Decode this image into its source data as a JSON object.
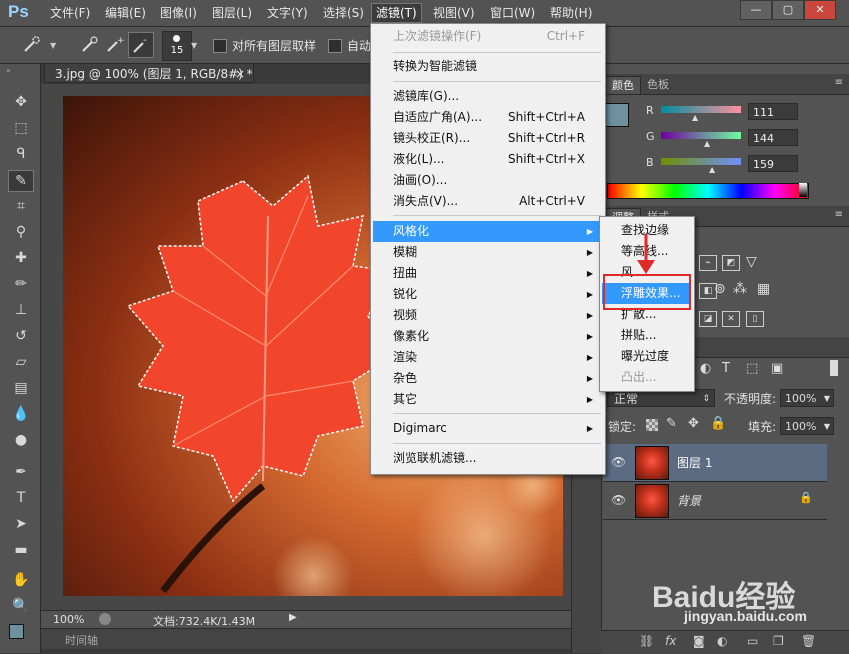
{
  "app": {
    "logo": "Ps"
  },
  "menubar": {
    "items": [
      "文件(F)",
      "编辑(E)",
      "图像(I)",
      "图层(L)",
      "文字(Y)",
      "选择(S)",
      "滤镜(T)",
      "视图(V)",
      "窗口(W)",
      "帮助(H)"
    ],
    "active": "滤镜(T)",
    "window_buttons": [
      "—",
      "▢",
      "✕"
    ]
  },
  "options": {
    "brush_size": "15",
    "sample_all_layers": "对所有图层取样",
    "auto_enhance": "自动"
  },
  "document": {
    "tab_title": "3.jpg @ 100% (图层 1, RGB/8#) *",
    "tab_close": "×"
  },
  "status": {
    "zoom": "100%",
    "doc_info": "文档:732.4K/1.43M"
  },
  "timeline": {
    "label": "时间轴"
  },
  "filter_menu": {
    "items": [
      {
        "label": "上次滤镜操作(F)",
        "shortcut": "Ctrl+F",
        "disabled": true
      },
      {
        "label": "转换为智能滤镜"
      },
      {
        "label": "滤镜库(G)..."
      },
      {
        "label": "自适应广角(A)...",
        "shortcut": "Shift+Ctrl+A"
      },
      {
        "label": "镜头校正(R)...",
        "shortcut": "Shift+Ctrl+R"
      },
      {
        "label": "液化(L)...",
        "shortcut": "Shift+Ctrl+X"
      },
      {
        "label": "油画(O)..."
      },
      {
        "label": "消失点(V)...",
        "shortcut": "Alt+Ctrl+V"
      },
      {
        "label": "风格化",
        "submenu": true,
        "highlighted": true
      },
      {
        "label": "模糊",
        "submenu": true
      },
      {
        "label": "扭曲",
        "submenu": true
      },
      {
        "label": "锐化",
        "submenu": true
      },
      {
        "label": "视频",
        "submenu": true
      },
      {
        "label": "像素化",
        "submenu": true
      },
      {
        "label": "渲染",
        "submenu": true
      },
      {
        "label": "杂色",
        "submenu": true
      },
      {
        "label": "其它",
        "submenu": true
      },
      {
        "label": "Digimarc",
        "submenu": true
      },
      {
        "label": "浏览联机滤镜..."
      }
    ]
  },
  "stylize_submenu": {
    "items": [
      {
        "label": "查找边缘"
      },
      {
        "label": "等高线..."
      },
      {
        "label": "风..."
      },
      {
        "label": "浮雕效果...",
        "highlighted": true
      },
      {
        "label": "扩散..."
      },
      {
        "label": "拼贴..."
      },
      {
        "label": "曝光过度"
      },
      {
        "label": "凸出...",
        "disabled": true
      }
    ]
  },
  "color_panel": {
    "tabs": [
      "颜色",
      "色板"
    ],
    "channels": [
      {
        "name": "R",
        "value": "111"
      },
      {
        "name": "G",
        "value": "144"
      },
      {
        "name": "B",
        "value": "159"
      }
    ],
    "swatch_color": "#6f909f"
  },
  "adjust_panel": {
    "tabs": [
      "调整",
      "样式"
    ]
  },
  "layers_panel": {
    "blend_mode": "正常",
    "opacity_label": "不透明度:",
    "opacity_value": "100%",
    "lock_label": "锁定:",
    "fill_label": "填充:",
    "fill_value": "100%",
    "layers": [
      {
        "name": "图层 1",
        "selected": true
      },
      {
        "name": "背景",
        "locked": true
      }
    ]
  },
  "watermark": {
    "brand": "Baidu经验",
    "url": "jingyan.baidu.com"
  },
  "colors": {
    "menu_highlight": "#3399ff",
    "annotation_red": "#e02a2a"
  }
}
